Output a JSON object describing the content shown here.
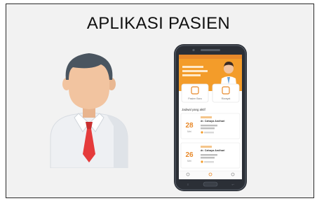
{
  "title": "APLIKASI PASIEN",
  "colors": {
    "frame_border": "#2a2a2a",
    "background": "#f2f2f2",
    "shirt": "#eef0f3",
    "tie": "#e53b3b",
    "hair": "#4a5560",
    "skin": "#f2c4a0",
    "app_header": "#f39c2a",
    "phone_body": "#2b2f36"
  },
  "icons": [
    "person-avatar-icon",
    "smartphone-icon"
  ],
  "app_screen": {
    "menu_1": "Pasien Baru",
    "menu_2": "Riwayat",
    "section_label": "Jadwal yang aktif",
    "cards": [
      {
        "day": "28",
        "month": "Mei",
        "name": "dr. Cahaya Andhari"
      },
      {
        "day": "26",
        "month": "Mei",
        "name": "dr. Cahaya Andhari"
      }
    ]
  }
}
